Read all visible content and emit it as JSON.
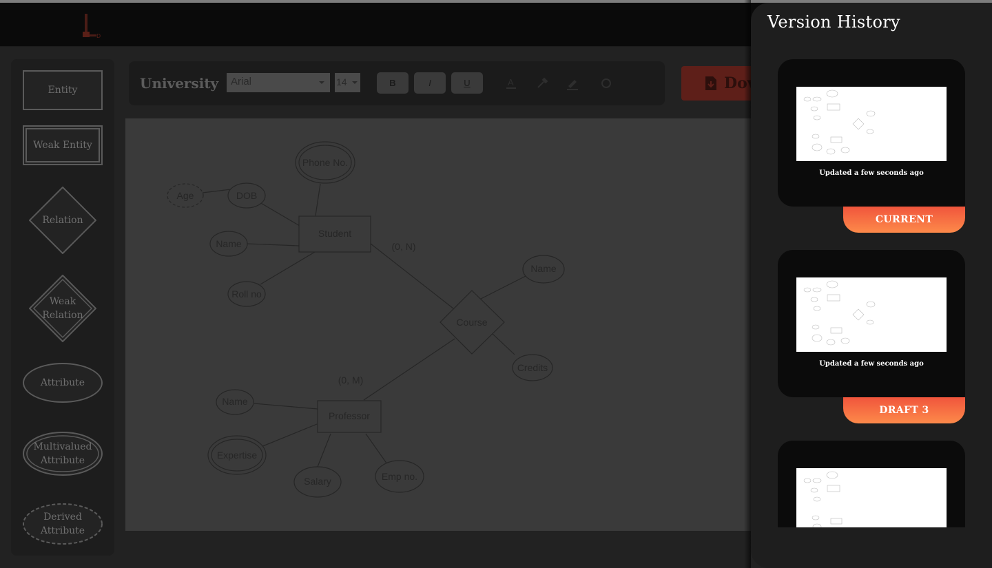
{
  "app": {
    "logo": "logo-icon"
  },
  "palette": {
    "items": [
      {
        "label": "Entity"
      },
      {
        "label": "Weak Entity"
      },
      {
        "label": "Relation"
      },
      {
        "label": "Weak Relation"
      },
      {
        "label": "Attribute"
      },
      {
        "label": "Multivalued Attribute"
      },
      {
        "label": "Derived Attribute"
      }
    ]
  },
  "toolbar": {
    "title": "University",
    "font_family": "Arial",
    "font_size": "14",
    "bold": "B",
    "italic": "I",
    "underline": "U",
    "download_label": "Dov"
  },
  "diagram": {
    "entities": [
      "Student",
      "Professor"
    ],
    "relation": "Course",
    "attributes": [
      "Phone No.",
      "Age",
      "DOB",
      "Name",
      "Roll no",
      "Name",
      "Credits",
      "Name",
      "Expertise",
      "Salary",
      "Emp no."
    ],
    "cardinality": [
      "(0, N)",
      "(0, M)"
    ]
  },
  "version_history": {
    "title": "Version History",
    "versions": [
      {
        "updated": "Updated a few seconds ago",
        "badge": "CURRENT"
      },
      {
        "updated": "Updated a few seconds ago",
        "badge": "DRAFT 3"
      },
      {
        "updated": "",
        "badge": ""
      }
    ]
  },
  "colors": {
    "accent_start": "#f0553c",
    "accent_end": "#fd8a4a",
    "panel_bg": "#1e1e1e",
    "card_bg": "#0b0b0b"
  }
}
